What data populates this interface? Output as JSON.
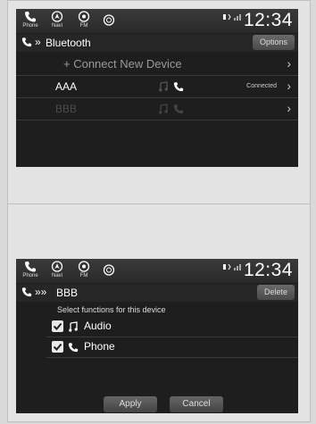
{
  "status_bar": {
    "apps": [
      {
        "label": "Phone",
        "icon": "phone-icon"
      },
      {
        "label": "Navi",
        "icon": "navi-icon"
      },
      {
        "label": "FM",
        "icon": "radio-icon"
      },
      {
        "label": "",
        "icon": "siri-icon"
      }
    ],
    "clock": "12:34"
  },
  "screen1": {
    "header": {
      "title": "Bluetooth",
      "options_label": "Options"
    },
    "connect_new": "+ Connect New Device",
    "devices": [
      {
        "name": "AAA",
        "status": "Connected"
      },
      {
        "name": "BBB",
        "status": ""
      }
    ]
  },
  "screen2": {
    "header": {
      "title": "BBB",
      "delete_label": "Delete"
    },
    "subtitle": "Select functions for this device",
    "functions": [
      {
        "label": "Audio",
        "checked": true,
        "icon": "music-note-icon"
      },
      {
        "label": "Phone",
        "checked": true,
        "icon": "phone-icon"
      }
    ],
    "apply_label": "Apply",
    "cancel_label": "Cancel"
  },
  "colors": {
    "screen_bg": "#1e1e1e",
    "dim_text": "#5a5a5a",
    "accent": "#ffffff"
  }
}
